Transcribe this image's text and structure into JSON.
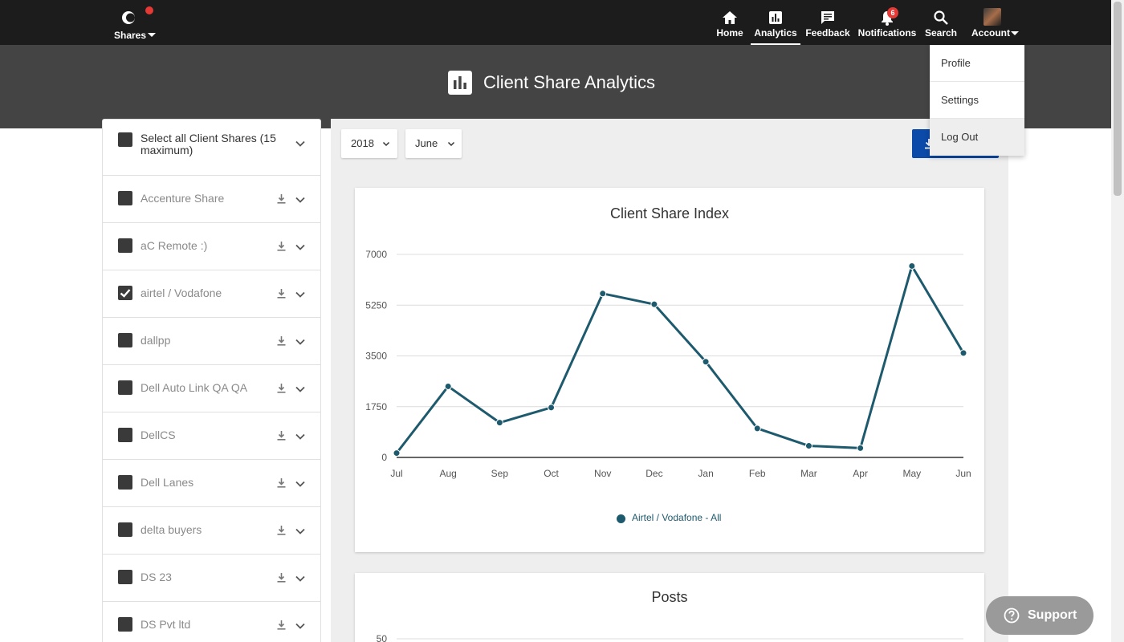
{
  "nav": {
    "brand_label": "Shares",
    "items": [
      {
        "label": "Home",
        "icon": "home-icon"
      },
      {
        "label": "Analytics",
        "icon": "analytics-icon"
      },
      {
        "label": "Feedback",
        "icon": "feedback-icon"
      },
      {
        "label": "Notifications",
        "icon": "bell-icon",
        "badge": "6"
      },
      {
        "label": "Search",
        "icon": "search-icon"
      },
      {
        "label": "Account",
        "icon": "avatar"
      }
    ],
    "active": "Analytics"
  },
  "header": {
    "title": "Client Share Analytics"
  },
  "sidebar": {
    "select_all_label": "Select all Client Shares (15 maximum)",
    "items": [
      {
        "label": "Accenture Share",
        "checked": false
      },
      {
        "label": "aC Remote :)",
        "checked": false
      },
      {
        "label": "airtel / Vodafone",
        "checked": true
      },
      {
        "label": "dallpp",
        "checked": false
      },
      {
        "label": "Dell Auto Link QA QA",
        "checked": false
      },
      {
        "label": "DellCS",
        "checked": false
      },
      {
        "label": "Dell Lanes",
        "checked": false
      },
      {
        "label": "delta buyers",
        "checked": false
      },
      {
        "label": "DS 23",
        "checked": false
      },
      {
        "label": "DS Pvt ltd",
        "checked": false
      }
    ]
  },
  "filters": {
    "year": "2018",
    "month": "June"
  },
  "account_menu": {
    "items": [
      "Profile",
      "Settings",
      "Log Out"
    ],
    "highlighted": "Log Out"
  },
  "support": {
    "label": "Support"
  },
  "colors": {
    "nav_bg": "#1c1c1c",
    "header_bg": "#444444",
    "series": "#1e5a6e",
    "download_button": "#0b4aa8",
    "badge": "#e53935"
  },
  "chart_data": [
    {
      "type": "line",
      "title": "Client Share Index",
      "categories": [
        "Jul",
        "Aug",
        "Sep",
        "Oct",
        "Nov",
        "Dec",
        "Jan",
        "Feb",
        "Mar",
        "Apr",
        "May",
        "Jun"
      ],
      "series": [
        {
          "name": "Airtel / Vodafone - All",
          "values": [
            150,
            2450,
            1200,
            1720,
            5650,
            5280,
            3300,
            1000,
            400,
            320,
            6600,
            3600
          ]
        }
      ],
      "ylim": [
        0,
        7000
      ],
      "yticks": [
        "0",
        "1750",
        "3500",
        "5250",
        "7000"
      ],
      "grid": true,
      "legend": "bottom"
    },
    {
      "type": "line",
      "title": "Posts",
      "yticks": [
        "50"
      ]
    }
  ]
}
